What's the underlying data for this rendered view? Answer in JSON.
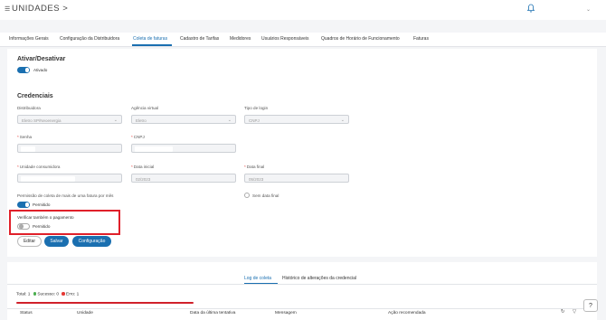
{
  "header": {
    "menu_icon": "☰",
    "title": "UNIDADES >",
    "chevron": "⌄"
  },
  "tabs": [
    "Informações Gerais",
    "Configuração da Distribuidora",
    "Coleta de faturas",
    "Cadastro de Tarifas",
    "Medidores",
    "Usuários Responsáveis",
    "Quadros de Horário de Funcionamento",
    "Faturas"
  ],
  "activate": {
    "title": "Ativar/Desativar",
    "toggle_label": "Ativado"
  },
  "credentials": {
    "title": "Credenciais",
    "distribuidora_label": "Distribuidora",
    "distribuidora_value": "Eletro SP/Neoenergia",
    "agencia_label": "Agência virtual",
    "agencia_value": "Eletro",
    "tipo_login_label": "Tipo de login",
    "tipo_login_value": "CNPJ",
    "senha_label": "Senha",
    "cnpj_label": "CNPJ",
    "unidade_label": "Unidade consumidora",
    "data_inicial_label": "Data inicial",
    "data_inicial_value": "02/2023",
    "data_final_label": "Data final",
    "data_final_value": "05/2023",
    "required_mark": "*"
  },
  "permissao": {
    "label": "Permissão de coleta de mais de uma fatura por mês",
    "toggle_label": "Permitido"
  },
  "sem_data_final": "Sem data final",
  "verificar": {
    "label": "Verificar também o pagamento",
    "toggle_label": "Permitido"
  },
  "buttons": {
    "editar": "Editar",
    "salvar": "Salvar",
    "configuracao": "Configuração"
  },
  "bottom_tabs": [
    "Log de coleta",
    "Histórico de alterações da credencial"
  ],
  "stats": {
    "total": "Total: 1",
    "sucesso": "Sucesso: 0",
    "erro": "Erro: 1"
  },
  "table_headers": [
    "Status",
    "Unidade",
    "Data da última tentativa",
    "Mensagem",
    "Ação recomendada"
  ],
  "help": "?",
  "colors": {
    "accent": "#1a6fb0",
    "success": "#4caf50",
    "error": "#e53935",
    "highlight": "#e0202a"
  }
}
